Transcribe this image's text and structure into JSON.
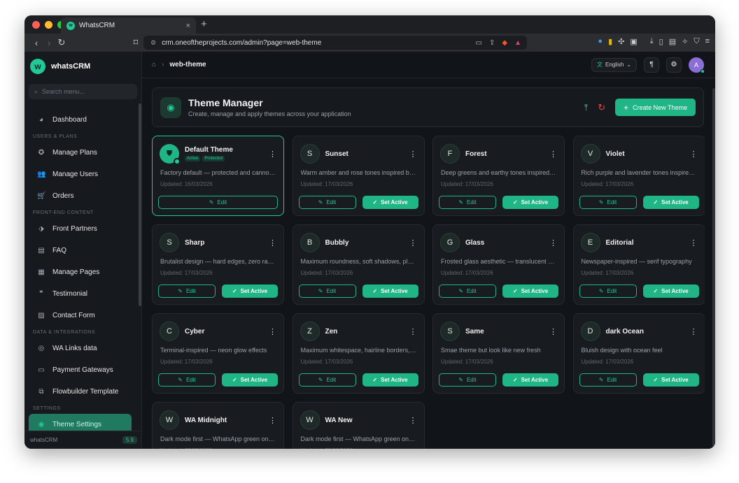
{
  "browser": {
    "tab_title": "WhatsCRM",
    "url": "crm.oneoftheprojects.com/admin?page=web-theme",
    "new_tab": "+",
    "close": "×"
  },
  "sidebar": {
    "brand": "whatsCRM",
    "search_placeholder": "Search menu...",
    "sections": {
      "users": "USERS & PLANS",
      "frontend": "FRONT-END CONTENT",
      "data": "DATA & INTEGRATIONS",
      "settings": "SETTINGS"
    },
    "items": {
      "dashboard": "Dashboard",
      "plans": "Manage Plans",
      "users": "Manage Users",
      "orders": "Orders",
      "partners": "Front Partners",
      "faq": "FAQ",
      "pages": "Manage Pages",
      "testimonial": "Testimonial",
      "contact": "Contact Form",
      "walinks": "WA Links data",
      "payment": "Payment Gateways",
      "flowbuilder": "Flowbuilder Template",
      "theme": "Theme Settings"
    },
    "footer_name": "whatsCRM",
    "version": "5.9"
  },
  "topbar": {
    "crumb": "web-theme",
    "language": "English"
  },
  "user": {
    "initial": "A"
  },
  "header": {
    "title": "Theme Manager",
    "subtitle": "Create, manage and apply themes across your application",
    "create_label": "Create New Theme"
  },
  "labels": {
    "edit": "Edit",
    "set_active": "Set Active",
    "badge_active": "Active",
    "badge_protected": "Protected"
  },
  "themes": [
    {
      "letter": "",
      "name": "Default Theme",
      "desc": "Factory default — protected and cannot be deleted",
      "updated": "Updated: 16/03/2026"
    },
    {
      "letter": "S",
      "name": "Sunset",
      "desc": "Warm amber and rose tones inspired by dusk",
      "updated": "Updated: 17/03/2026"
    },
    {
      "letter": "F",
      "name": "Forest",
      "desc": "Deep greens and earthy tones inspired by nature",
      "updated": "Updated: 17/03/2026"
    },
    {
      "letter": "V",
      "name": "Violet",
      "desc": "Rich purple and lavender tones inspired by twilight",
      "updated": "Updated: 17/03/2026"
    },
    {
      "letter": "S",
      "name": "Sharp",
      "desc": "Brutalist design — hard edges, zero radius",
      "updated": "Updated: 17/03/2026"
    },
    {
      "letter": "B",
      "name": "Bubbly",
      "desc": "Maximum roundness, soft shadows, playful",
      "updated": "Updated: 17/03/2026"
    },
    {
      "letter": "G",
      "name": "Glass",
      "desc": "Frosted glass aesthetic — translucent panels",
      "updated": "Updated: 17/03/2026"
    },
    {
      "letter": "E",
      "name": "Editorial",
      "desc": "Newspaper-inspired — serif typography",
      "updated": "Updated: 17/03/2026"
    },
    {
      "letter": "C",
      "name": "Cyber",
      "desc": "Terminal-inspired — neon glow effects",
      "updated": "Updated: 17/03/2026"
    },
    {
      "letter": "Z",
      "name": "Zen",
      "desc": "Maximum whitespace, hairline borders, calm",
      "updated": "Updated: 17/03/2026"
    },
    {
      "letter": "S",
      "name": "Same",
      "desc": "Smae theme but look like new fresh",
      "updated": "Updated: 17/03/2026"
    },
    {
      "letter": "D",
      "name": "dark Ocean",
      "desc": "Bluish design with ocean feel",
      "updated": "Updated: 17/03/2026"
    },
    {
      "letter": "W",
      "name": "WA Midnight",
      "desc": "Dark mode first — WhatsApp green on black",
      "updated": "Updated: 20/03/2026"
    },
    {
      "letter": "W",
      "name": "WA New",
      "desc": "Dark mode first — WhatsApp green on dark",
      "updated": "Updated: 20/03/2026"
    }
  ],
  "colors": {
    "accent": "#1fb585",
    "bg": "#111418",
    "card": "#181c20"
  }
}
